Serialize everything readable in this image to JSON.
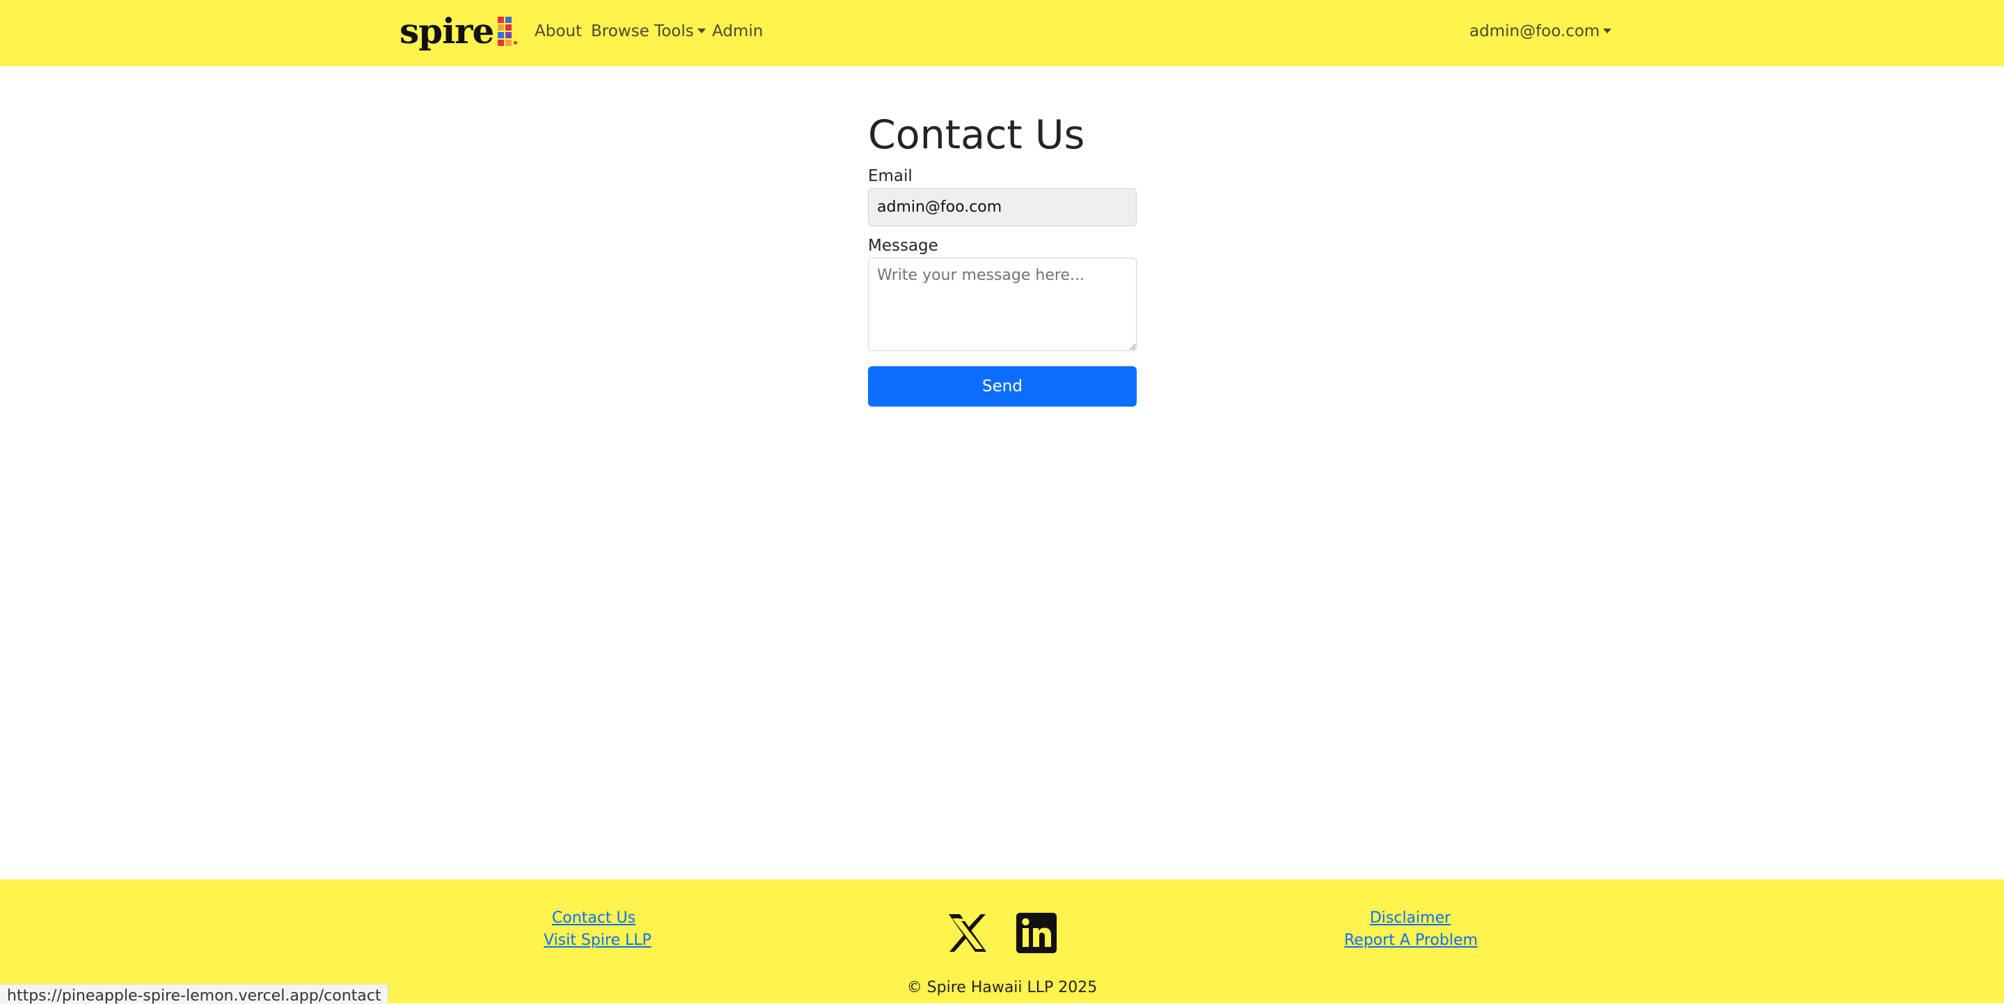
{
  "colors": {
    "navbar_bg": "#fff34d",
    "footer_bg": "#fff34d",
    "primary": "#0d6efd",
    "link": "#0d6efd",
    "input_disabled_bg": "#efefef"
  },
  "navbar": {
    "brand": "spire",
    "links": {
      "about": "About",
      "browse_tools": "Browse Tools",
      "admin": "Admin"
    },
    "user_menu": "admin@foo.com"
  },
  "contact_form": {
    "title": "Contact Us",
    "email_label": "Email",
    "email_value": "admin@foo.com",
    "message_label": "Message",
    "message_placeholder": "Write your message here...",
    "submit_label": "Send"
  },
  "footer": {
    "left_links": {
      "contact": "Contact Us",
      "visit": "Visit Spire LLP"
    },
    "social_icons": [
      "x-icon",
      "linkedin-icon"
    ],
    "right_links": {
      "disclaimer": "Disclaimer",
      "report": "Report A Problem"
    },
    "copyright": "© Spire Hawaii LLP 2025"
  },
  "browser": {
    "status_url": "https://pineapple-spire-lemon.vercel.app/contact"
  }
}
